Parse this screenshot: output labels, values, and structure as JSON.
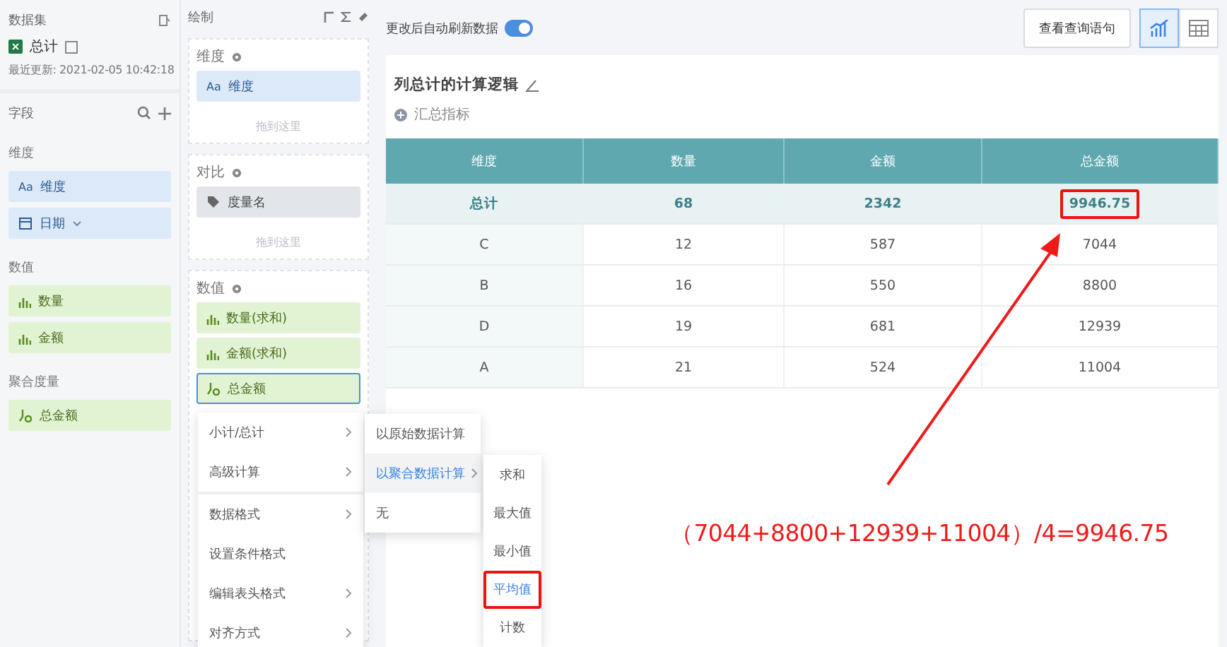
{
  "dataset_panel": {
    "title": "数据集",
    "file": "总计",
    "updated": "最近更新: 2021-02-05 10:42:18"
  },
  "fields_panel": {
    "title": "字段",
    "groups": [
      {
        "title": "维度",
        "items": [
          {
            "label": "维度",
            "kind": "text",
            "glyph": "Aa",
            "expandable": false
          },
          {
            "label": "日期",
            "kind": "date",
            "expandable": true
          }
        ]
      },
      {
        "title": "数值",
        "items": [
          {
            "label": "数量",
            "kind": "number",
            "expandable": false
          },
          {
            "label": "金额",
            "kind": "number",
            "expandable": false
          }
        ]
      },
      {
        "title": "聚合度量",
        "items": [
          {
            "label": "总金额",
            "kind": "calc",
            "expandable": false
          }
        ]
      }
    ]
  },
  "draw_panel": {
    "title": "绘制",
    "sections": [
      {
        "title": "维度",
        "drop_hint": "拖到这里",
        "items": [
          {
            "label": "维度",
            "kind": "text",
            "glyph": "Aa",
            "focused": false
          }
        ]
      },
      {
        "title": "对比",
        "drop_hint": "拖到这里",
        "items": [
          {
            "label": "度量名",
            "kind": "tag",
            "focused": false
          }
        ]
      },
      {
        "title": "数值",
        "items": [
          {
            "label": "数量(求和)",
            "kind": "number",
            "focused": false
          },
          {
            "label": "金额(求和)",
            "kind": "number",
            "focused": false
          },
          {
            "label": "总金额",
            "kind": "calc",
            "focused": true
          }
        ]
      }
    ]
  },
  "toolbar": {
    "auto_refresh": {
      "label": "更改后自动刷新数据",
      "on": true
    },
    "query_button": "查看查询语句",
    "views": [
      {
        "kind": "chart",
        "selected": true
      },
      {
        "kind": "table",
        "selected": false
      }
    ]
  },
  "report": {
    "title": "列总计的计算逻辑",
    "add_metric": "汇总指标",
    "table": {
      "columns": [
        "维度",
        "数量",
        "金额",
        "总金额"
      ],
      "total_row": [
        {
          "text": "总计",
          "marked": false
        },
        {
          "text": "68",
          "marked": false
        },
        {
          "text": "2342",
          "marked": false
        },
        {
          "text": "9946.75",
          "marked": true
        }
      ],
      "rows": [
        [
          "C",
          "12",
          "587",
          "7044"
        ],
        [
          "B",
          "16",
          "550",
          "8800"
        ],
        [
          "D",
          "19",
          "681",
          "12939"
        ],
        [
          "A",
          "21",
          "524",
          "11004"
        ]
      ]
    }
  },
  "context_menu": {
    "items": [
      {
        "label": "小计/总计",
        "submenu": true
      },
      {
        "label": "高级计算",
        "submenu": true
      },
      {
        "label": "数据格式",
        "submenu": true
      },
      {
        "label": "设置条件格式",
        "submenu": false
      },
      {
        "label": "编辑表头格式",
        "submenu": true
      },
      {
        "label": "对齐方式",
        "submenu": true
      }
    ],
    "submenu": [
      {
        "label": "以原始数据计算",
        "selected": false,
        "submenu": false
      },
      {
        "label": "以聚合数据计算",
        "selected": true,
        "submenu": true
      },
      {
        "label": "无",
        "selected": false,
        "submenu": false
      }
    ],
    "aggregations": [
      {
        "label": "求和",
        "selected": false,
        "marked": false
      },
      {
        "label": "最大值",
        "selected": false,
        "marked": false
      },
      {
        "label": "最小值",
        "selected": false,
        "marked": false
      },
      {
        "label": "平均值",
        "selected": true,
        "marked": true
      },
      {
        "label": "计数",
        "selected": false,
        "marked": false
      }
    ]
  },
  "annotation": {
    "formula": "（7044+8800+12939+11004）/4=9946.75"
  }
}
